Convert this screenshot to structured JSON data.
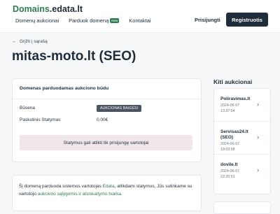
{
  "header": {
    "logo_part1": "Domains",
    "logo_part2": ".edata.lt",
    "nav": [
      {
        "label": "Domenų aukcionai"
      },
      {
        "label": "Parduok domeną",
        "badge": "New"
      },
      {
        "label": "Kontaktai"
      }
    ],
    "login_label": "Prisijungti",
    "register_label": "Registruotis"
  },
  "back_label": "Grįžti į sąrašą",
  "page_title": "mitas-moto.lt (SEO)",
  "auction_card": {
    "title": "Domenas parduodamas aukciono būdu",
    "status_label": "Būsena",
    "status_value": "AUKCIONAS BAIGĖSI",
    "last_bid_label": "Paskutinis Statymas",
    "last_bid_value": "0.00€",
    "notice": "Statymus gali atlikti tik prisijungę vartotojai"
  },
  "info": {
    "part1": "Šį domeną parduoda sistemos vartotojas ",
    "seller": "Edata",
    "part2": ", atlikdami statymus, Jūs sutinkame su vartotojo ",
    "terms_link": "aukciono sąlygomis ir atsiskaitymo tvarka",
    "part3": "."
  },
  "sidebar": {
    "title": "Kiti aukcionai",
    "auctions": [
      {
        "name": "Poliravimas.lt",
        "date": "2024-06-07",
        "time": "13:37:54"
      },
      {
        "name": "Servisas24.lt (SEO)",
        "date": "2024-06-07",
        "time": "18:03:58"
      },
      {
        "name": "dovile.lt",
        "date": "2024-06-07",
        "time": "22:20:51"
      }
    ]
  },
  "colors": {
    "brand_green": "#2e7d4f",
    "dark": "#1f2d3a",
    "notice_bg": "#f1e7ea"
  }
}
